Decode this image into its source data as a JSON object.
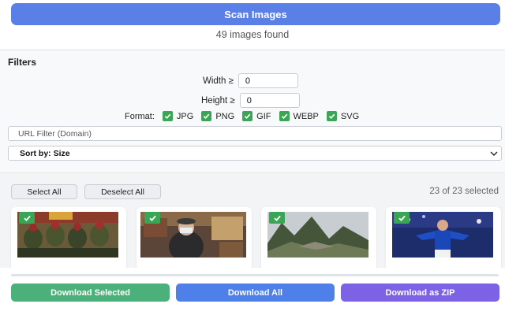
{
  "scan": {
    "button_label": "Scan Images",
    "found_text": "49 images found"
  },
  "filters": {
    "title": "Filters",
    "width_label": "Width ≥",
    "width_value": "0",
    "height_label": "Height ≥",
    "height_value": "0",
    "format_label": "Format:",
    "formats": [
      {
        "label": "JPG",
        "checked": true
      },
      {
        "label": "PNG",
        "checked": true
      },
      {
        "label": "GIF",
        "checked": true
      },
      {
        "label": "WEBP",
        "checked": true
      },
      {
        "label": "SVG",
        "checked": true
      }
    ],
    "url_filter_placeholder": "URL Filter (Domain)",
    "sort_label": "Sort by: Size"
  },
  "selection": {
    "select_all_label": "Select All",
    "deselect_all_label": "Deselect All",
    "count_text": "23 of 23 selected"
  },
  "thumbnails": [
    {
      "name": "thumbnail-soldiers",
      "checked": true
    },
    {
      "name": "thumbnail-restaurant",
      "checked": true
    },
    {
      "name": "thumbnail-mountains",
      "checked": true
    },
    {
      "name": "thumbnail-football",
      "checked": true
    }
  ],
  "downloads": {
    "selected_label": "Download Selected",
    "all_label": "Download All",
    "zip_label": "Download as ZIP"
  },
  "colors": {
    "scan_button": "#5a7fe6",
    "download_selected": "#4cb07a",
    "download_all": "#4f7fe8",
    "download_zip": "#7d62e6",
    "checkbox": "#3aa655"
  }
}
